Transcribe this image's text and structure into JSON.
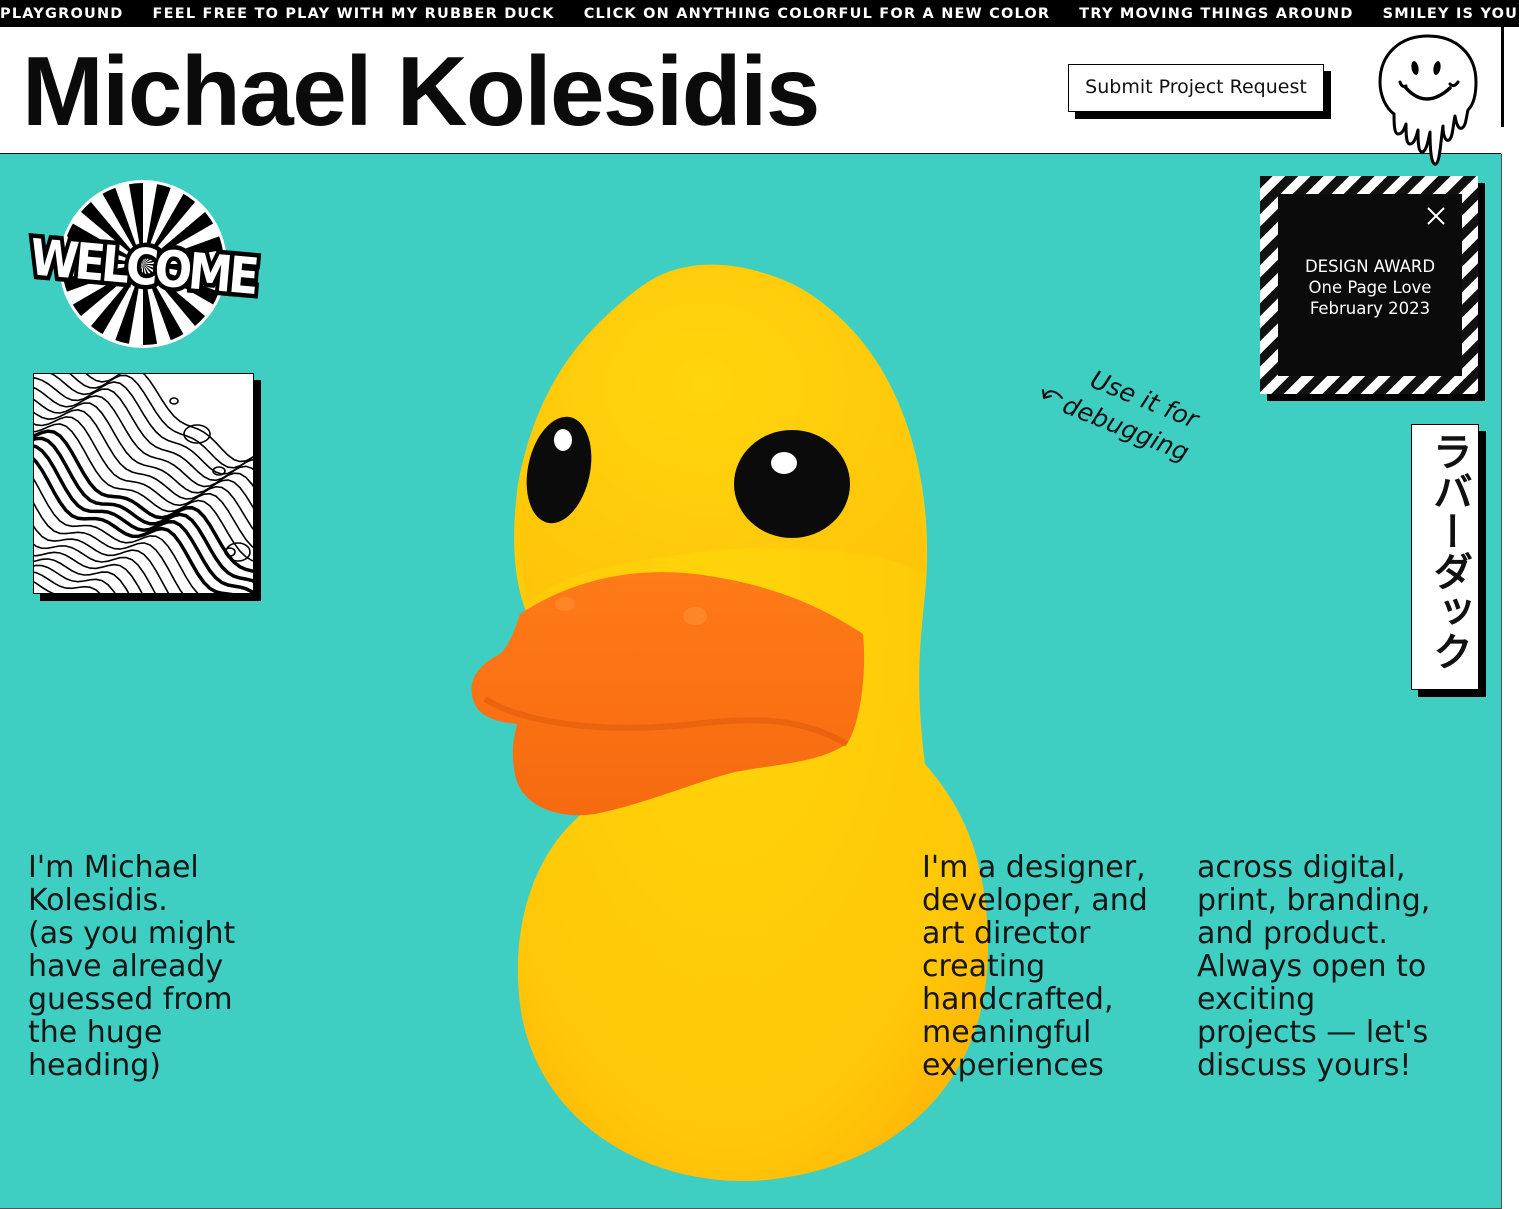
{
  "ticker": {
    "items": [
      "PLAYGROUND",
      "FEEL FREE TO PLAY WITH MY RUBBER DUCK",
      "CLICK ON ANYTHING COLORFUL FOR A NEW COLOR",
      "TRY MOVING THINGS AROUND",
      "SMILEY IS YOUR FR"
    ]
  },
  "header": {
    "title": "Michael Kolesidis",
    "submit_label": "Submit Project Request"
  },
  "welcome": {
    "text": "WELCOME"
  },
  "note": {
    "line1": "Use it for",
    "line2": "debugging"
  },
  "award": {
    "line1": "DESIGN AWARD",
    "line2": "One Page Love",
    "line3": "February 2023"
  },
  "jp_tag": {
    "text": "ラバーダック"
  },
  "intro": {
    "left": [
      "I'm Michael",
      "Kolesidis.",
      "(as you might",
      "have already",
      "guessed from",
      "the huge",
      "heading)"
    ],
    "middle": [
      "I'm a designer,",
      "developer, and",
      "art director",
      "creating",
      "handcrafted,",
      "meaningful",
      "experiences"
    ],
    "right": [
      "across digital,",
      "print, branding,",
      "and product.",
      "Always open to",
      "exciting",
      "projects — let's",
      "discuss yours!"
    ]
  },
  "colors": {
    "stage": "#3ecfc2",
    "duck_body": "#ffd10a",
    "duck_beak": "#ff6e12",
    "ink": "#000000"
  },
  "icons": [
    "close-icon",
    "smiley-icon",
    "curved-arrow-icon"
  ]
}
